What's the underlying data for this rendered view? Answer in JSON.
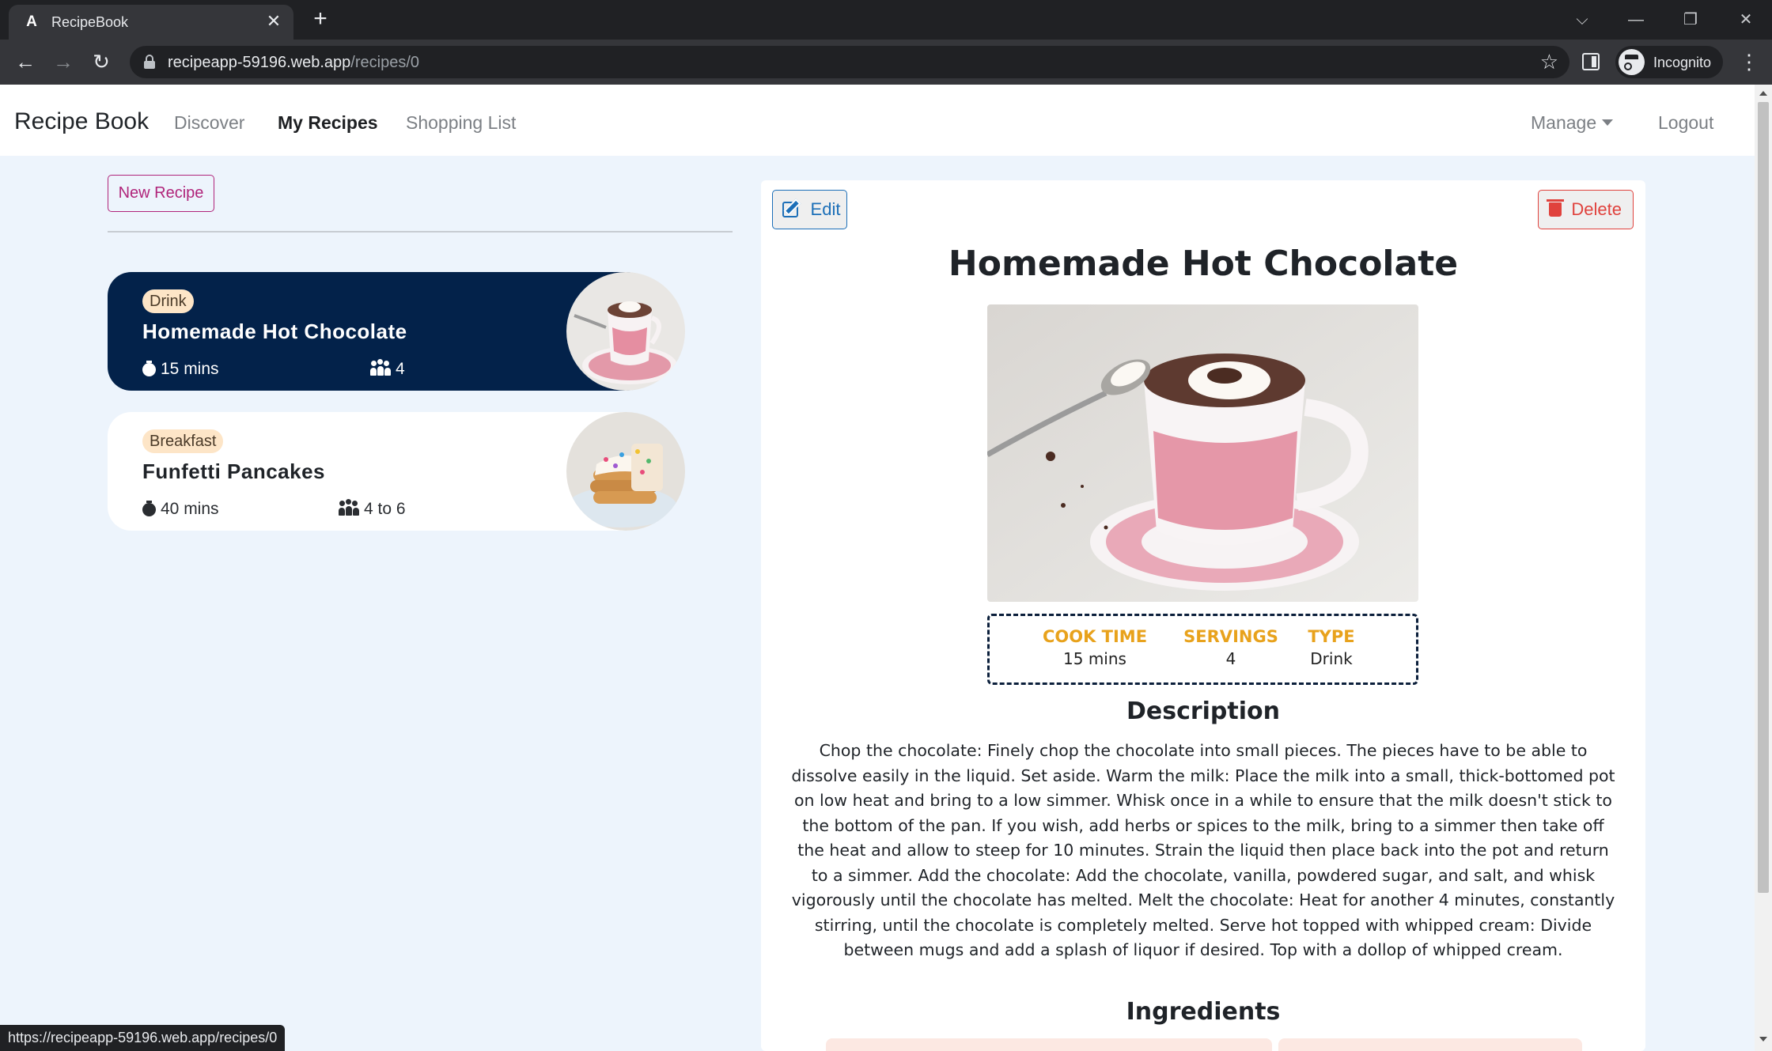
{
  "browser": {
    "tab_title": "RecipeBook",
    "tab_favicon": "A",
    "url_host": "recipeapp-59196.web.app",
    "url_path": "/recipes/0",
    "profile_label": "Incognito",
    "status_url": "https://recipeapp-59196.web.app/recipes/0"
  },
  "nav": {
    "brand": "Recipe Book",
    "links": [
      "Discover",
      "My Recipes",
      "Shopping List"
    ],
    "manage": "Manage",
    "logout": "Logout"
  },
  "list": {
    "new_recipe": "New Recipe",
    "recipes": [
      {
        "category": "Drink",
        "title": "Homemade Hot Chocolate",
        "time": "15 mins",
        "servings": "4"
      },
      {
        "category": "Breakfast",
        "title": "Funfetti Pancakes",
        "time": "40 mins",
        "servings": "4 to 6"
      }
    ]
  },
  "detail": {
    "edit": "Edit",
    "delete": "Delete",
    "title": "Homemade Hot Chocolate",
    "stats": {
      "cook_time_label": "COOK TIME",
      "cook_time": "15 mins",
      "servings_label": "SERVINGS",
      "servings": "4",
      "type_label": "TYPE",
      "type": "Drink"
    },
    "description_heading": "Description",
    "description": "Chop the chocolate: Finely chop the chocolate into small pieces. The pieces have to be able to dissolve easily in the liquid. Set aside. Warm the milk: Place the milk into a small, thick-bottomed pot on low heat and bring to a low simmer. Whisk once in a while to ensure that the milk doesn't stick to the bottom of the pan. If you wish, add herbs or spices to the milk, bring to a simmer then take off the heat and allow to steep for 10 minutes. Strain the liquid then place back into the pot and return to a simmer. Add the chocolate: Add the chocolate, vanilla, powdered sugar, and salt, and whisk vigorously until the chocolate has melted. Melt the chocolate: Heat for another 4 minutes, constantly stirring, until the chocolate is completely melted. Serve hot topped with whipped cream: Divide between mugs and add a splash of liquor if desired. Top with a dollop of whipped cream.",
    "ingredients_heading": "Ingredients"
  },
  "colors": {
    "selected_card": "#03224a",
    "accent_pink": "#b0247a",
    "stat_label": "#e8a21c",
    "edit_blue": "#1c6fb8",
    "delete_red": "#e0423d",
    "page_bg": "#edf4fc"
  },
  "icons": {
    "tab_close": "close-icon",
    "new_tab": "plus-icon",
    "back": "arrow-left-icon",
    "forward": "arrow-right-icon",
    "reload": "reload-icon",
    "bookmark": "star-icon",
    "edit": "pen-to-square-icon",
    "delete": "trash-icon",
    "timer": "stopwatch-icon",
    "servings": "people-group-icon"
  }
}
